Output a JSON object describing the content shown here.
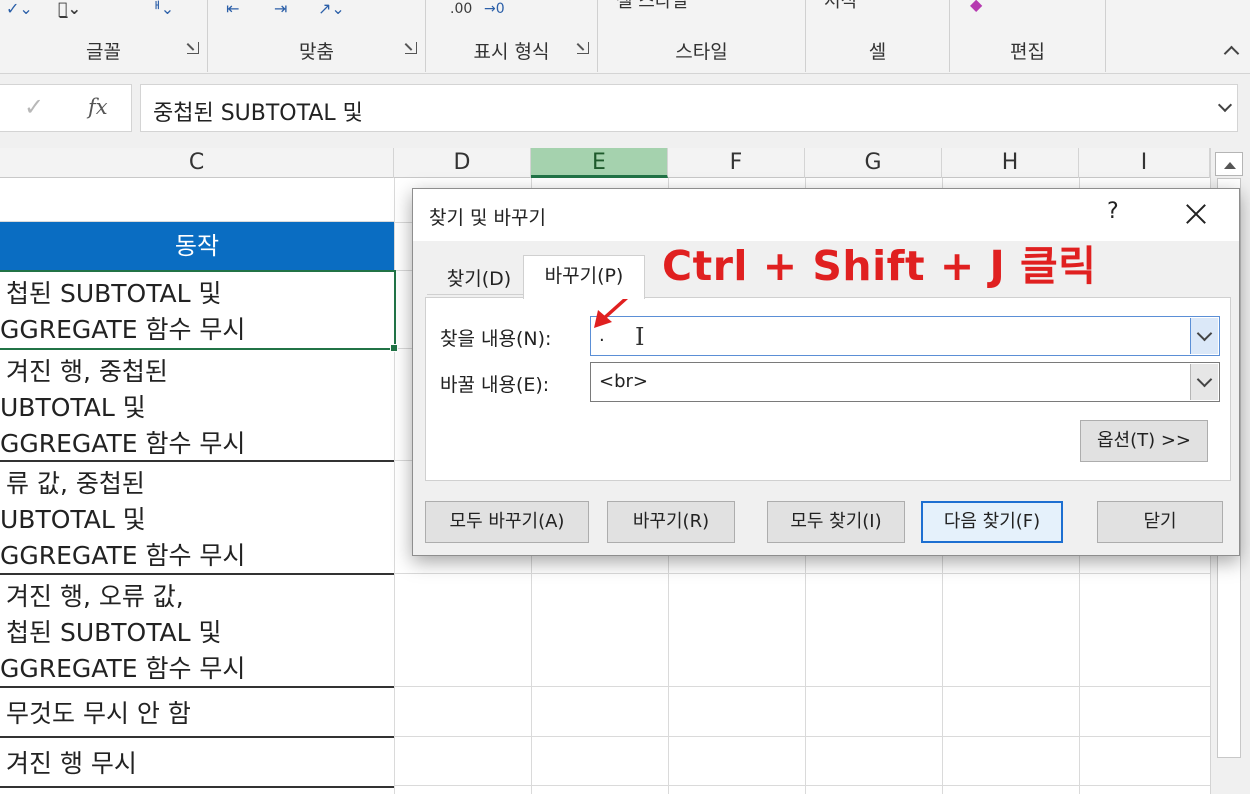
{
  "ribbon": {
    "groups": [
      {
        "label": "글꼴"
      },
      {
        "label": "맞춤"
      },
      {
        "label": "표시 형식"
      },
      {
        "label": "스타일",
        "top_text": "셀 스타일"
      },
      {
        "label": "셀",
        "top_text": "서식"
      },
      {
        "label": "편집"
      }
    ]
  },
  "formula_bar": {
    "fx": "fx",
    "value": "중첩된 SUBTOTAL 및"
  },
  "columns": [
    "C",
    "D",
    "E",
    "F",
    "G",
    "H",
    "I"
  ],
  "selected_column": "E",
  "column_c": {
    "header": "동작",
    "rows": [
      [
        "첩된 SUBTOTAL 및",
        "GGREGATE 함수 무시"
      ],
      [
        "겨진 행, 중첩된",
        "UBTOTAL 및",
        "GGREGATE 함수 무시"
      ],
      [
        "류 값, 중첩된",
        "UBTOTAL 및",
        "GGREGATE 함수 무시"
      ],
      [
        "겨진 행, 오류 값,",
        "첩된 SUBTOTAL 및",
        "GGREGATE 함수 무시"
      ],
      [
        "무것도 무시 안 함"
      ],
      [
        "겨진 행 무시"
      ]
    ]
  },
  "dialog": {
    "title": "찾기 및 바꾸기",
    "help": "?",
    "tabs": [
      "찾기(D)",
      "바꾸기(P)"
    ],
    "active_tab": "바꾸기(P)",
    "find_label": "찾을 내용(N):",
    "find_value": ".",
    "replace_label": "바꿀 내용(E):",
    "replace_value": "<br>",
    "options_button": "옵션(T) >>",
    "buttons": {
      "replace_all": "모두 바꾸기(A)",
      "replace": "바꾸기(R)",
      "find_all": "모두 찾기(I)",
      "find_next": "다음 찾기(F)",
      "close": "닫기"
    }
  },
  "annotation": {
    "text": "Ctrl + Shift + J 클릭",
    "color": "#e02020"
  },
  "colors": {
    "header_blue": "#0a6dc2",
    "excel_green": "#217346",
    "selected_col": "#a5d2ae"
  }
}
